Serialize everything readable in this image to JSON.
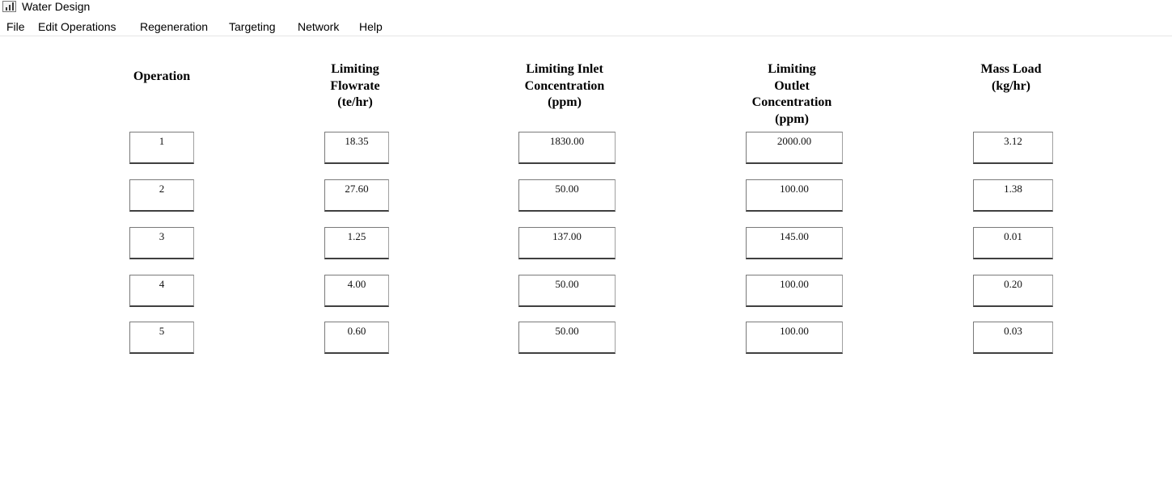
{
  "window": {
    "title": "Water Design",
    "icon": "factory-icon"
  },
  "menu": [
    "File",
    "Edit Operations",
    "Regeneration",
    "Targeting",
    "Network",
    "Help"
  ],
  "table": {
    "headers": [
      "Operation",
      "Limiting\nFlowrate\n(te/hr)",
      "Limiting Inlet\nConcentration\n(ppm)",
      "Limiting\nOutlet\nConcentration\n(ppm)",
      "Mass Load\n(kg/hr)"
    ],
    "rows": [
      [
        "1",
        "18.35",
        "1830.00",
        "2000.00",
        "3.12"
      ],
      [
        "2",
        "27.60",
        "50.00",
        "100.00",
        "1.38"
      ],
      [
        "3",
        "1.25",
        "137.00",
        "145.00",
        "0.01"
      ],
      [
        "4",
        "4.00",
        "50.00",
        "100.00",
        "0.20"
      ],
      [
        "5",
        "0.60",
        "50.00",
        "100.00",
        "0.03"
      ]
    ]
  }
}
